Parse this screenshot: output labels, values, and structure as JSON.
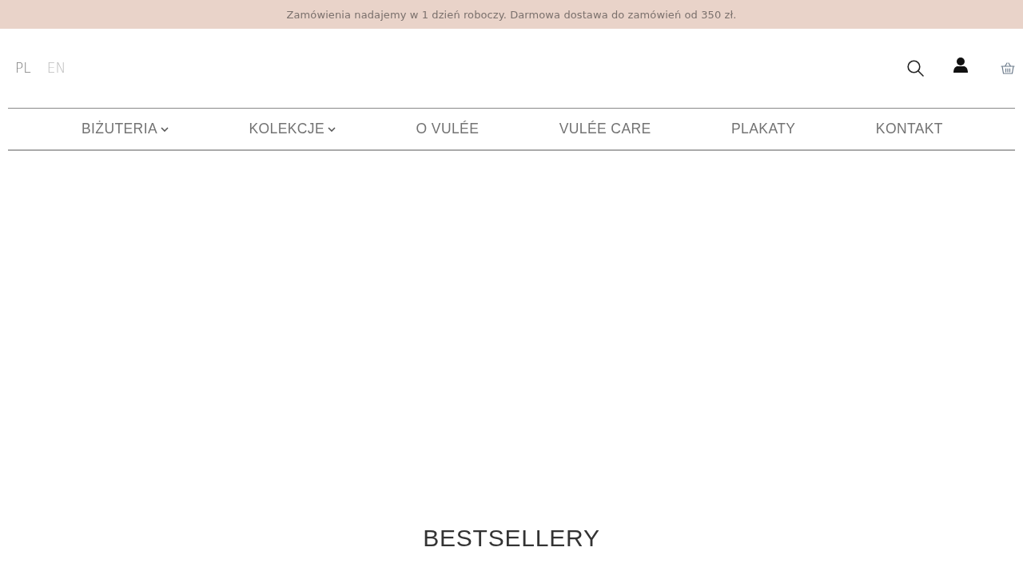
{
  "announcement_bar": {
    "text": "Zamówienia nadajemy w 1 dzień roboczy. Darmowa dostawa do zamówień od 350 zł."
  },
  "header": {
    "languages": [
      {
        "label": "PL",
        "selected": true
      },
      {
        "label": "EN",
        "selected": false
      }
    ]
  },
  "nav": {
    "items": [
      {
        "label": "BIŻUTERIA",
        "has_dropdown": true
      },
      {
        "label": "KOLEKCJE",
        "has_dropdown": true
      },
      {
        "label": "O VULÉE",
        "has_dropdown": false
      },
      {
        "label": "VULÉE CARE",
        "has_dropdown": false
      },
      {
        "label": "PLAKATY",
        "has_dropdown": false
      },
      {
        "label": "KONTAKT",
        "has_dropdown": false
      }
    ]
  },
  "bestsellers": {
    "title": "BESTSELLERY"
  }
}
